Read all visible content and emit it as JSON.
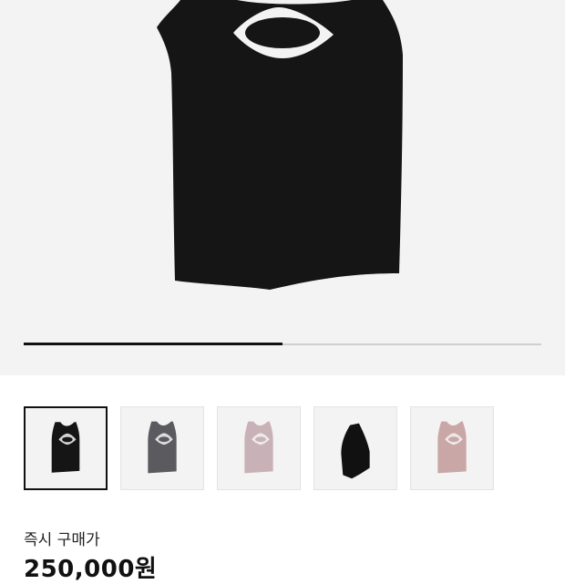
{
  "product": {
    "images": [
      {
        "variant": "black",
        "color": "#151515",
        "selected": true
      },
      {
        "variant": "charcoal",
        "color": "#5a5a5f",
        "selected": false
      },
      {
        "variant": "mauve",
        "color": "#c9b2b7",
        "selected": false
      },
      {
        "variant": "black-asymmetric",
        "color": "#111111",
        "selected": false
      },
      {
        "variant": "dusty-pink",
        "color": "#c9a7a6",
        "selected": false
      }
    ],
    "gallery_progress": 0.5
  },
  "price": {
    "label": "즉시 구매가",
    "value": "250,000원"
  },
  "colors": {
    "background": "#ffffff",
    "image_background": "#f3f3f3",
    "text": "#111111"
  }
}
